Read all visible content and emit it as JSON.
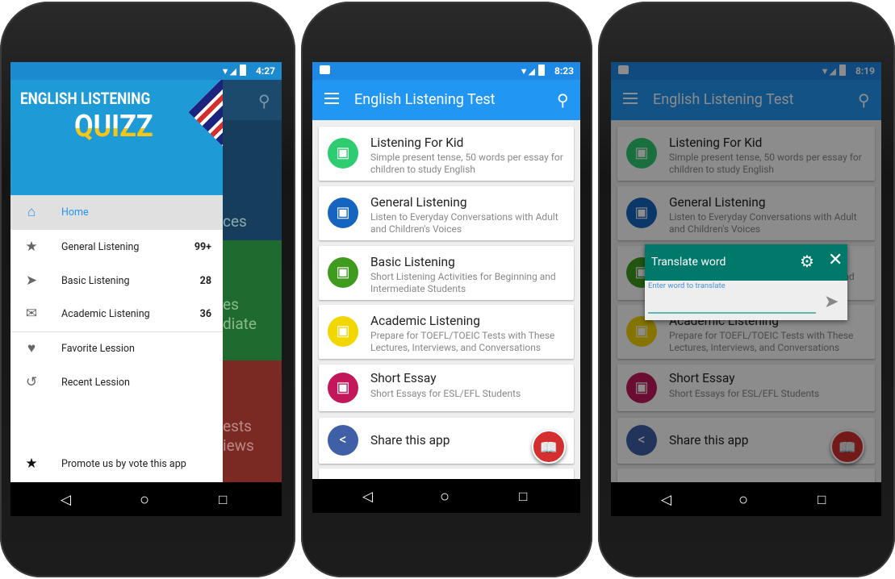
{
  "phone1": {
    "status_time": "4:27",
    "logo_line1": "ENGLISH LISTENING",
    "logo_line2": "QUIZZ",
    "drawer": [
      {
        "label": "Home",
        "icon": "home-icon",
        "count": ""
      },
      {
        "label": "General Listening",
        "icon": "star-icon",
        "count": "99+"
      },
      {
        "label": "Basic Listening",
        "icon": "send-icon",
        "count": "28"
      },
      {
        "label": "Academic Listening",
        "icon": "mail-open-icon",
        "count": "36"
      },
      {
        "label": "Favorite Lession",
        "icon": "heart-icon",
        "count": ""
      },
      {
        "label": "Recent Lession",
        "icon": "history-icon",
        "count": ""
      },
      {
        "label": "Promote us by vote this app",
        "icon": "star-icon",
        "count": ""
      }
    ],
    "behind_text": [
      "ces",
      "es",
      "diate",
      "ests",
      "iews"
    ]
  },
  "phone2": {
    "status_time": "8:23"
  },
  "phone3": {
    "status_time": "8:19",
    "dialog": {
      "title": "Translate word",
      "label": "Enter word to translate",
      "value": ""
    }
  },
  "app": {
    "title": "English Listening Test",
    "items": [
      {
        "title": "Listening For Kid",
        "subtitle": "Simple present tense, 50 words per essay for children to study English",
        "color": "#2ecc71"
      },
      {
        "title": "General Listening",
        "subtitle": "Listen to Everyday Conversations with Adult and Children's Voices",
        "color": "#1565c0"
      },
      {
        "title": "Basic Listening",
        "subtitle": "Short Listening Activities for Beginning and Intermediate Students",
        "color": "#3f9b1e"
      },
      {
        "title": "Academic Listening",
        "subtitle": "Prepare for TOEFL/TOEIC Tests with These Lectures, Interviews, and Conversations",
        "color": "#f2d600"
      },
      {
        "title": "Short Essay",
        "subtitle": "Short Essays for ESL/EFL Students",
        "color": "#c2185b"
      }
    ],
    "share_label": "Share this app",
    "colors": {
      "primary": "#2196f3",
      "status": "#1e88e5",
      "dialog": "#00796b",
      "fab": "#d32f2f"
    }
  }
}
